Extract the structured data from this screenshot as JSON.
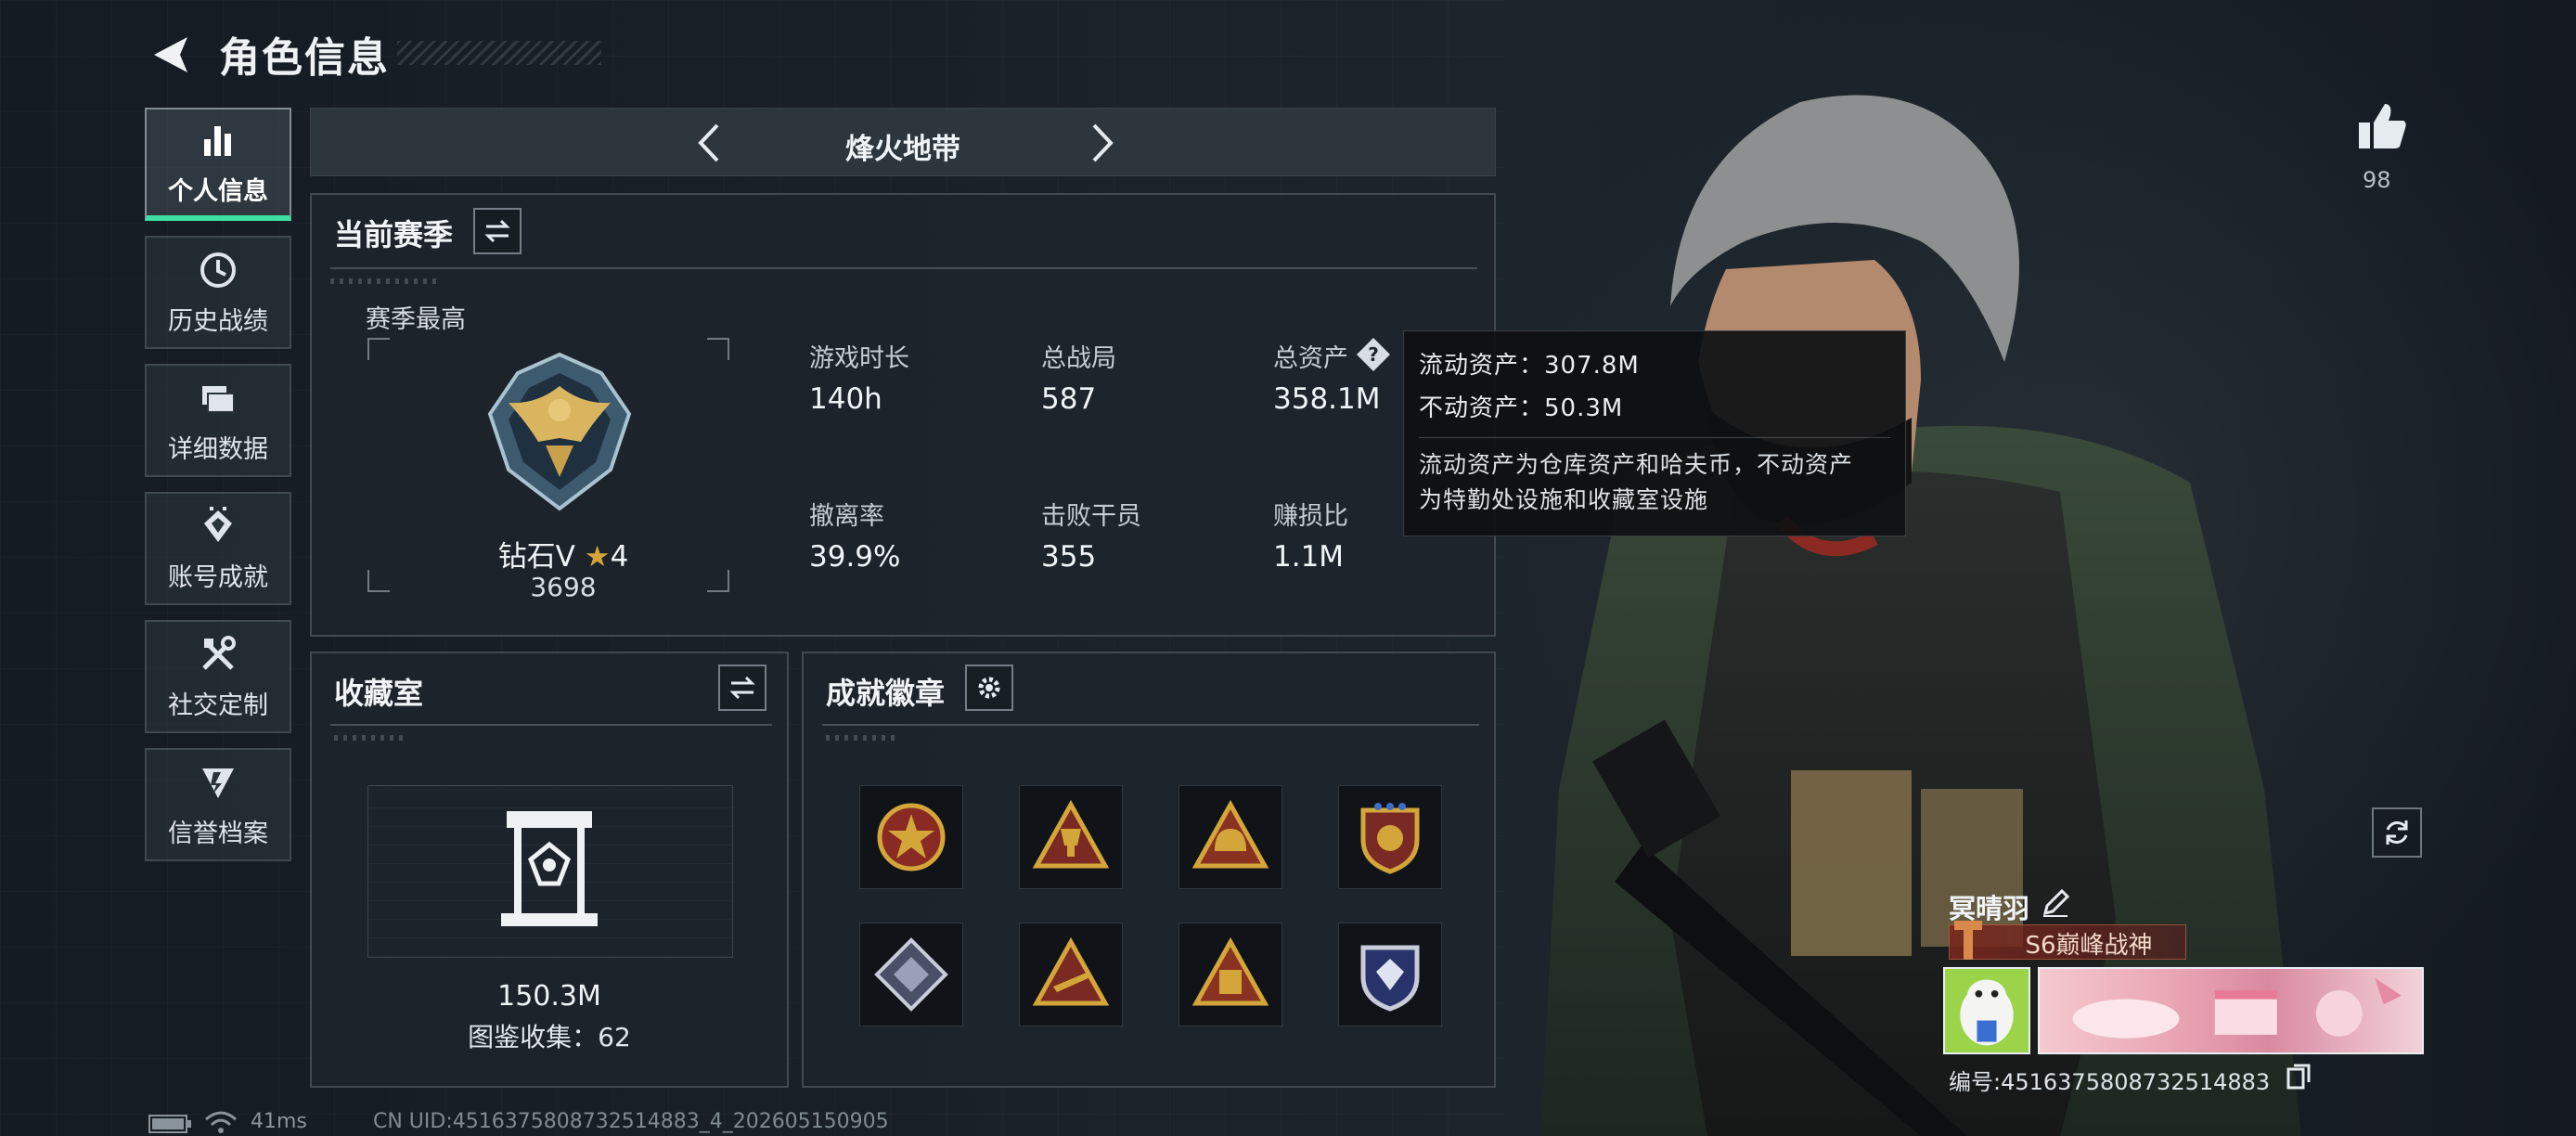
{
  "header": {
    "title": "角色信息"
  },
  "sidebar": {
    "items": [
      {
        "label": "个人信息",
        "icon": "bar-chart-icon",
        "active": true
      },
      {
        "label": "历史战绩",
        "icon": "history-clock-icon",
        "active": false
      },
      {
        "label": "详细数据",
        "icon": "folder-data-icon",
        "active": false
      },
      {
        "label": "账号成就",
        "icon": "achievement-icon",
        "active": false
      },
      {
        "label": "社交定制",
        "icon": "tools-icon",
        "active": false
      },
      {
        "label": "信誉档案",
        "icon": "credit-shield-icon",
        "active": false
      }
    ]
  },
  "mode": {
    "name": "烽火地带"
  },
  "season": {
    "title": "当前赛季",
    "best_label": "赛季最高",
    "rank_name": "钻石V",
    "rank_stars": "4",
    "rank_score": "3698",
    "stats": [
      {
        "label": "游戏时长",
        "value": "140h"
      },
      {
        "label": "总战局",
        "value": "587"
      },
      {
        "label": "总资产",
        "value": "358.1M"
      },
      {
        "label": "撤离率",
        "value": "39.9%"
      },
      {
        "label": "击败干员",
        "value": "355"
      },
      {
        "label": "赚损比",
        "value": "1.1M"
      }
    ]
  },
  "tooltip": {
    "liquid": "流动资产：307.8M",
    "fixed": "不动资产：50.3M",
    "note_line1": "流动资产为仓库资产和哈夫币，不动资产",
    "note_line2": "为特勤处设施和收藏室设施"
  },
  "collection": {
    "title": "收藏室",
    "value": "150.3M",
    "catalog": "图鉴收集：62"
  },
  "achievements": {
    "title": "成就徽章",
    "badges": [
      "star-medal-icon",
      "trophy-triangle-icon",
      "helmet-triangle-icon",
      "shield-crest-icon",
      "diamond-emblem-icon",
      "rifle-triangle-icon",
      "crate-triangle-icon",
      "gem-shield-icon"
    ]
  },
  "player": {
    "likes": "98",
    "name": "冥晴羽",
    "title": "S6巅峰战神",
    "id_line": "编号:4516375808732514883"
  },
  "status": {
    "ping": "41ms",
    "uid": "CN UID:4516375808732514883_4_202605150905"
  },
  "colors": {
    "accent_green": "#3fe0a3",
    "panel_bg": "#1e252c",
    "gold": "#d4a63a"
  }
}
